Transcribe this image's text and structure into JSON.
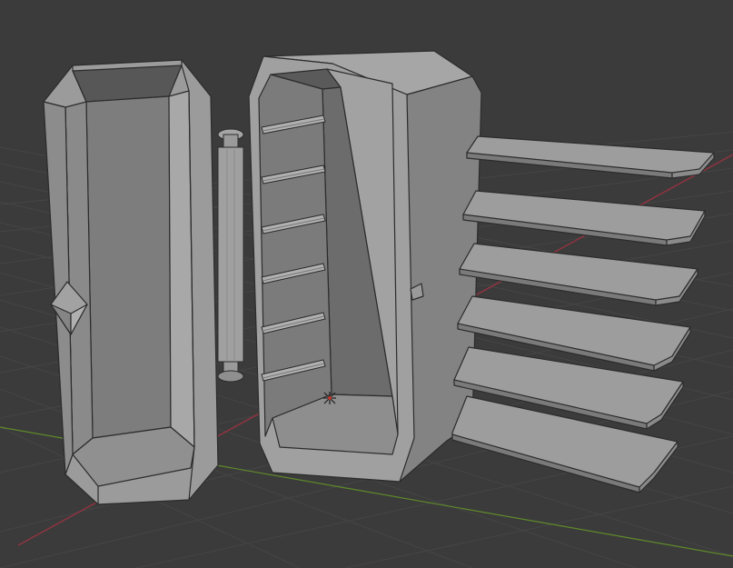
{
  "viewport": {
    "background_color": "#3b3b3b",
    "grid_color": "#464646",
    "x_axis_color": "#a33b45",
    "y_axis_color": "#6f9a2e",
    "mesh_face_color": "#9a9a9a",
    "mesh_shadow_color": "#6e6e6e",
    "mesh_edge_color": "#2e2e2e"
  },
  "scene": {
    "objects": [
      "cabinet-door",
      "hinge-cylinder",
      "cabinet-body",
      "shelf-rail",
      "shelf-plate",
      "origin-gizmo-icon"
    ],
    "shelf_count": 6,
    "rail_count": 6
  }
}
